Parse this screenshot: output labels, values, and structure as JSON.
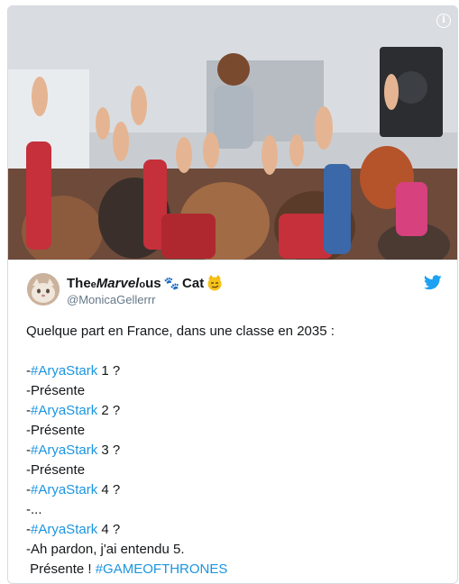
{
  "tweet": {
    "display_name_part1": "The",
    "display_name_part2": "Marvel",
    "display_name_part3": "us",
    "display_name_part4": "Cat",
    "handle": "@MonicaGellerrr",
    "info_icon": "info-icon",
    "bird_icon": "twitter-bird-icon",
    "bird_color": "#1da1f2",
    "hashtag_color": "#1b95e0",
    "lines": [
      {
        "text": "Quelque part en France, dans une classe en 2035 :"
      },
      {
        "text": ""
      },
      {
        "prefix": "-",
        "tag": "#AryaStark",
        "suffix": " 1 ?"
      },
      {
        "text": "-Présente"
      },
      {
        "prefix": "-",
        "tag": "#AryaStark",
        "suffix": " 2 ?"
      },
      {
        "text": "-Présente"
      },
      {
        "prefix": "-",
        "tag": "#AryaStark",
        "suffix": " 3 ?"
      },
      {
        "text": "-Présente"
      },
      {
        "prefix": "-",
        "tag": "#AryaStark",
        "suffix": " 4 ?"
      },
      {
        "text": "-..."
      },
      {
        "prefix": "-",
        "tag": "#AryaStark",
        "suffix": " 4 ?"
      },
      {
        "text": "-Ah pardon, j'ai entendu 5."
      },
      {
        "prefix": " Présente ! ",
        "tag": "#GAMEOFTHRONES",
        "suffix": ""
      }
    ]
  }
}
